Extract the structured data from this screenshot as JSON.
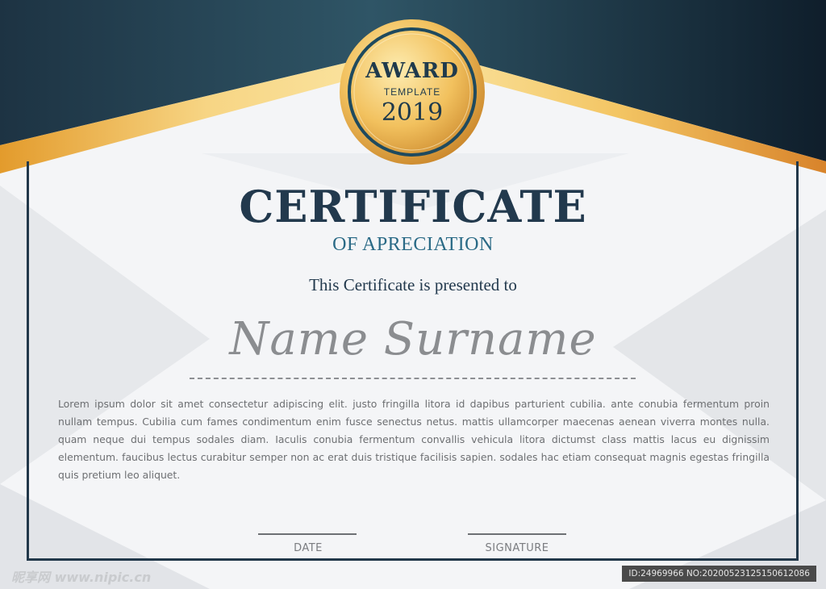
{
  "badge": {
    "award": "AWARD",
    "template": "TEMPLATE",
    "year": "2019"
  },
  "certificate": {
    "title": "CERTIFICATE",
    "subtitle": "OF APRECIATION",
    "presented_to": "This Certificate is presented to",
    "name": "Name Surname",
    "body": "Lorem ipsum dolor sit amet consectetur adipiscing elit. justo fringilla litora id dapibus parturient cubilia. ante conubia fermentum proin nullam tempus. Cubilia cum fames condimentum enim fusce senectus netus. mattis ullamcorper maecenas aenean viverra montes nulla. quam neque dui tempus sodales diam. Iaculis conubia fermentum convallis vehicula litora dictumst class mattis lacus eu dignissim elementum. faucibus lectus curabitur semper non ac erat duis tristique facilisis sapien. sodales hac etiam consequat magnis egestas fringilla quis pretium leo aliquet."
  },
  "footer": {
    "date_label": "DATE",
    "signature_label": "SIGNATURE"
  },
  "watermark": {
    "site": "昵享网 www.nipic.cn",
    "id_text": "ID:24969966 NO:20200523125150612086"
  },
  "colors": {
    "navy": "#22384a",
    "gold": "#e8b54a",
    "teal": "#2a6a86"
  }
}
